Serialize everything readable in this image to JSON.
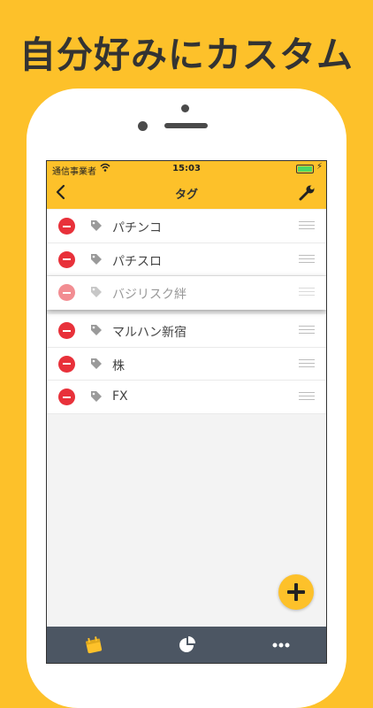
{
  "headline": "自分好みにカスタム",
  "status_bar": {
    "carrier": "通信事業者",
    "time": "15:03"
  },
  "nav": {
    "title": "タグ",
    "back_icon": "chevron-left-icon",
    "settings_icon": "wrench-icon"
  },
  "tags": [
    {
      "label": "パチンコ"
    },
    {
      "label": "パチスロ"
    },
    {
      "label": "バジリスク絆",
      "state": "dragging"
    },
    {
      "label": "マルハン新宿"
    },
    {
      "label": "株"
    },
    {
      "label": "FX"
    }
  ],
  "fab": {
    "icon": "plus-icon"
  },
  "tabbar": {
    "items": [
      {
        "icon": "calendar-icon"
      },
      {
        "icon": "pie-chart-icon"
      },
      {
        "icon": "more-icon"
      }
    ]
  },
  "colors": {
    "accent": "#FDC12A",
    "delete": "#E8313A",
    "tabbar": "#4C5663"
  }
}
